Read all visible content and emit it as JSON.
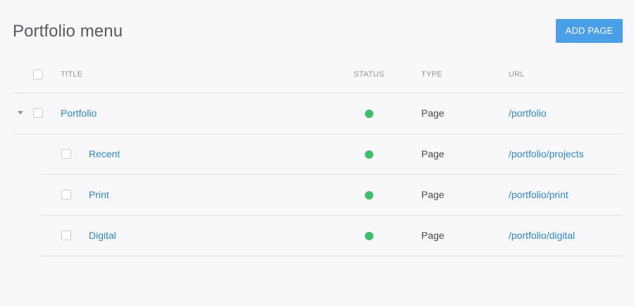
{
  "header": {
    "title": "Portfolio menu",
    "add_button_label": "ADD PAGE"
  },
  "table": {
    "columns": {
      "title": "TITLE",
      "status": "STATUS",
      "type": "TYPE",
      "url": "URL"
    },
    "rows": [
      {
        "title": "Portfolio",
        "status": "published",
        "type": "Page",
        "url": "/portfolio",
        "level": 0,
        "expanded": true
      },
      {
        "title": "Recent",
        "status": "published",
        "type": "Page",
        "url": "/portfolio/projects",
        "level": 1
      },
      {
        "title": "Print",
        "status": "published",
        "type": "Page",
        "url": "/portfolio/print",
        "level": 1
      },
      {
        "title": "Digital",
        "status": "published",
        "type": "Page",
        "url": "/portfolio/digital",
        "level": 1
      }
    ]
  },
  "colors": {
    "accent": "#4a9fe6",
    "link": "#2f86c9",
    "status_published": "#3fbf6b",
    "divider": "#dddfe3",
    "background": "#f8f8fa"
  },
  "icons": {
    "expand": "caret-down-icon",
    "status": "status-dot-icon"
  }
}
